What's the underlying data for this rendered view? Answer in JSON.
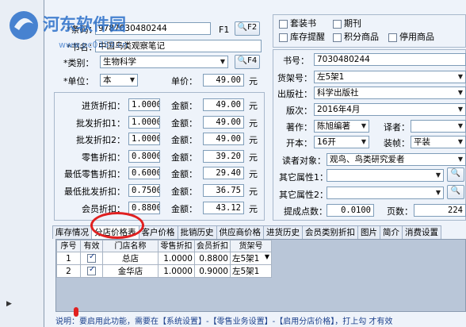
{
  "watermark": {
    "site_name": "河东软件园",
    "url": "www.pc0359.cn"
  },
  "form": {
    "barcode_label": "*条码：",
    "barcode_value": "9787030480244",
    "f1_label": "F1",
    "f2_label": "F2",
    "title_label": "*书名：",
    "title_value": "中国鸟类观察笔记",
    "category_label": "*类别：",
    "category_value": "生物科学",
    "f4_label": "F4",
    "unit_label": "*单位：",
    "unit_value": "本",
    "unit_price_label": "单价：",
    "unit_price_value": "49.00",
    "yuan": "元"
  },
  "discounts": {
    "amount_label": "金额：",
    "yuan": "元",
    "rows": [
      {
        "label": "进货折扣：",
        "rate": "1.0000",
        "amount": "49.00"
      },
      {
        "label": "批发折扣1：",
        "rate": "1.0000",
        "amount": "49.00"
      },
      {
        "label": "批发折扣2：",
        "rate": "1.0000",
        "amount": "49.00"
      },
      {
        "label": "零售折扣：",
        "rate": "0.8000",
        "amount": "39.20"
      },
      {
        "label": "最低零售折扣：",
        "rate": "0.6000",
        "amount": "29.40"
      },
      {
        "label": "最低批发折扣：",
        "rate": "0.7500",
        "amount": "36.75"
      },
      {
        "label": "会员折扣：",
        "rate": "0.8800",
        "amount": "43.12"
      }
    ]
  },
  "checkboxes": {
    "set_book": "套装书",
    "periodical": "期刊",
    "stock_alert": "库存提醒",
    "points_item": "积分商品",
    "disabled_item": "停用商品"
  },
  "info": {
    "book_no_label": "书号：",
    "book_no_value": "7030480244",
    "shelf_label": "货架号：",
    "shelf_value": "左5架1",
    "publisher_label": "出版社：",
    "publisher_value": "科学出版社",
    "edition_label": "版次：",
    "edition_value": "2016年4月",
    "author_label": "著作：",
    "author_value": "陈旭编著",
    "translator_label": "译者：",
    "format_label": "开本：",
    "format_value": "16开",
    "binding_label": "装帧：",
    "binding_value": "平装",
    "readers_label": "读者对象：",
    "readers_value": "观鸟、鸟类研究爱者",
    "attr1_label": "其它属性1：",
    "attr2_label": "其它属性2：",
    "points_label": "提成点数：",
    "points_value": "0.0100",
    "pages_label": "页数：",
    "pages_value": "224"
  },
  "tabs": [
    "库存情况",
    "分店价格表",
    "客户价格",
    "批销历史",
    "供应商价格",
    "进货历史",
    "会员类别折扣",
    "图片",
    "简介",
    "消费设置"
  ],
  "grid": {
    "columns": [
      "序号",
      "有效",
      "门店名称",
      "零售折扣",
      "会员折扣",
      "货架号"
    ],
    "rows": [
      {
        "no": "1",
        "valid": true,
        "store": "总店",
        "retail": "1.0000",
        "member": "0.8800",
        "shelf": "左5架1"
      },
      {
        "no": "2",
        "valid": true,
        "store": "金华店",
        "retail": "1.0000",
        "member": "0.9000",
        "shelf": "左5架1"
      }
    ]
  },
  "note": "说明：要启用此功能，需要在【系统设置】-【零售业务设置】-【启用分店价格】，打上勾 才有效",
  "colors": {
    "highlight": "#e02020",
    "watermark": "#2a6fc9"
  }
}
